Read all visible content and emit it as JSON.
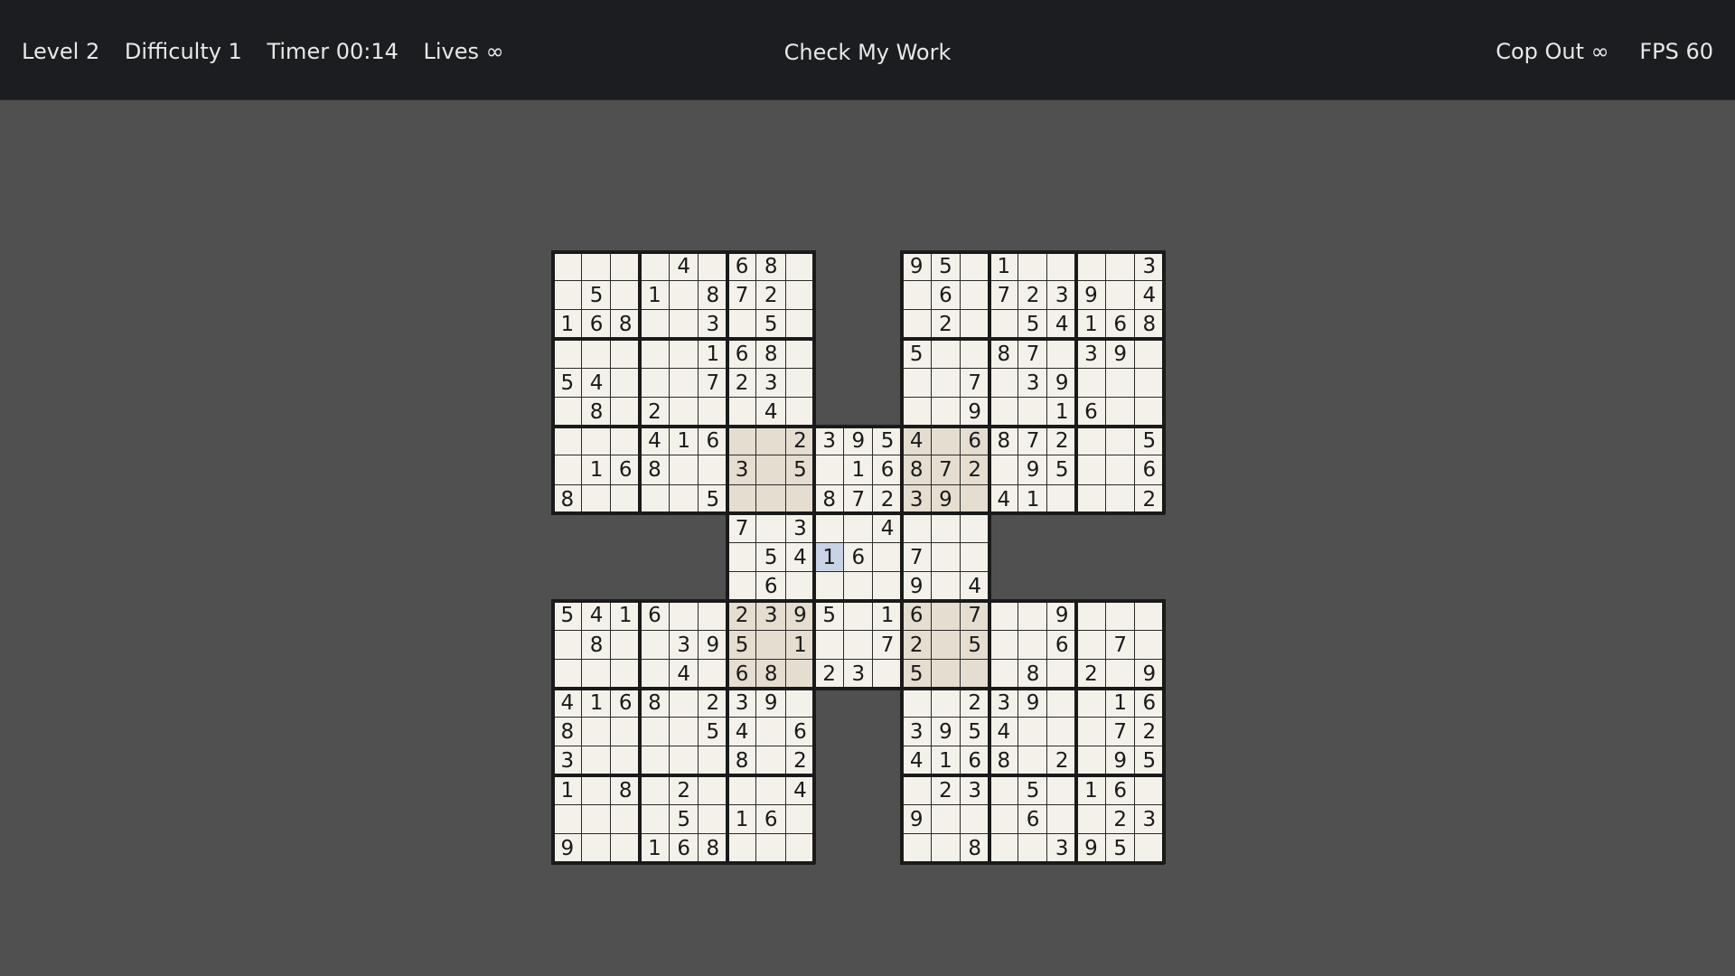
{
  "header": {
    "level": "Level 2",
    "difficulty": "Difficulty 1",
    "timer": "Timer 00:14",
    "lives": "Lives ∞",
    "check_button": "Check My Work",
    "cop_out": "Cop Out ∞",
    "fps": "FPS 60"
  },
  "puzzle": {
    "type": "samurai-sudoku",
    "selected_cell": {
      "row": 10,
      "col": 9
    },
    "rows": [
      "....4.68.   95.1....3",
      ".5.1.872.   .6.7239.4",
      "168..3.5.   .2..54168",
      ".....168.   5..87.39",
      "54...723.   ..7.39...",
      ".8.2...4.   ..9..16..",
      "...416..2395 4.6872..5",
      ".168..3.5.168 72.95..6",
      "8....5...872 39.41...2",
      "      7.3..4...",
      "      .5416.7..",
      "      .6....9.4",
      "5416..2395.16.7..9...",
      ".8..395.1..72.5..6.7",
      "....4.68.23.5...8.2.9",
      "4168.239.   ..239..16",
      "8....54.6   3954...72",
      "3.....8.2   4168.2.95",
      "1.8.2...4   .23.5.16.",
      "....5.16.   9...6..23",
      "9..168...   ..8..395."
    ]
  }
}
